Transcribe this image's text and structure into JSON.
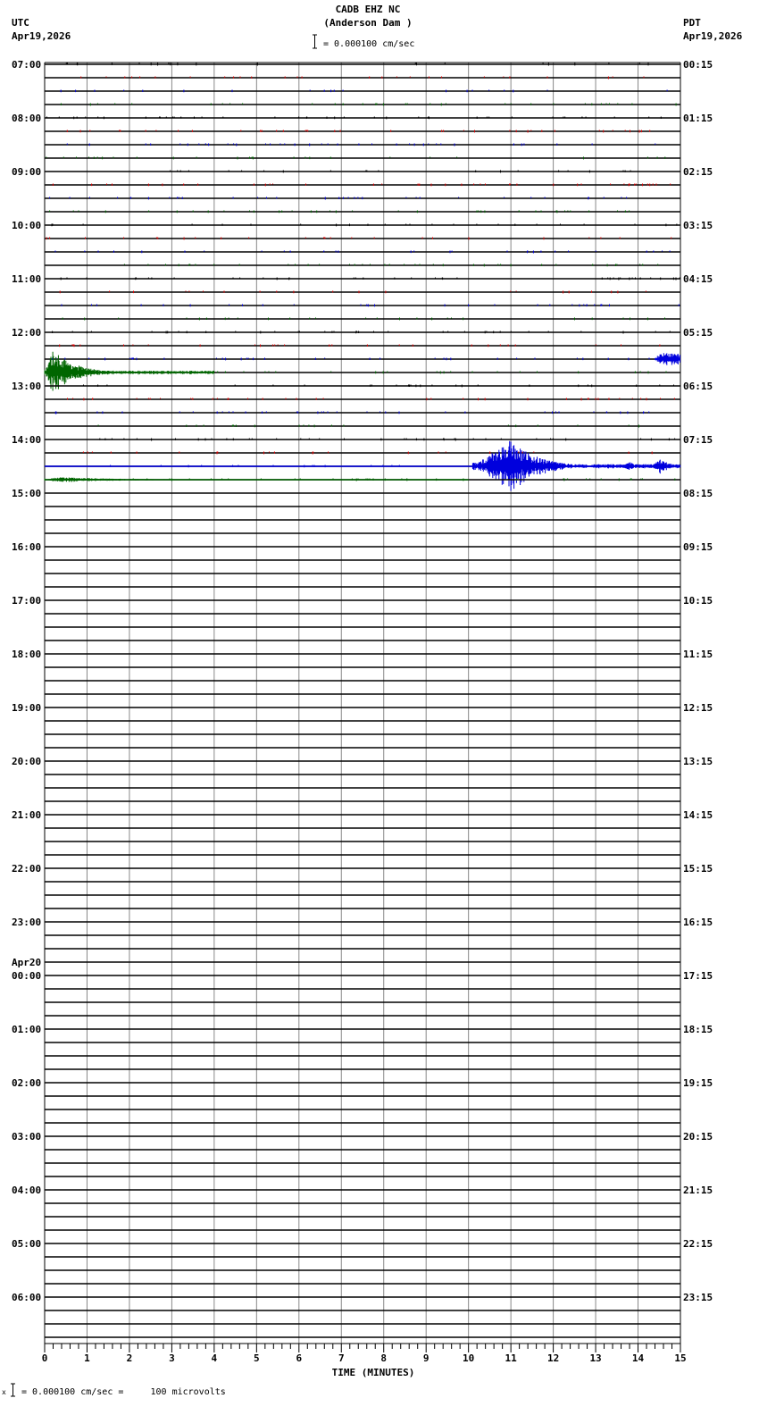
{
  "chart_data": {
    "type": "line",
    "title": "CADB EHZ NC",
    "subtitle": "(Anderson Dam )",
    "scale_label": "= 0.000100 cm/sec",
    "left_timezone": "UTC",
    "left_date": "Apr19,2026",
    "right_timezone": "PDT",
    "right_date": "Apr19,2026",
    "left_hour_labels": [
      "07:00",
      "08:00",
      "09:00",
      "10:00",
      "11:00",
      "12:00",
      "13:00",
      "14:00",
      "15:00",
      "16:00",
      "17:00",
      "18:00",
      "19:00",
      "20:00",
      "21:00",
      "22:00",
      "23:00",
      "00:00",
      "01:00",
      "02:00",
      "03:00",
      "04:00",
      "05:00",
      "06:00"
    ],
    "date_change_label": "Apr20",
    "right_hour_labels": [
      "00:15",
      "01:15",
      "02:15",
      "03:15",
      "04:15",
      "05:15",
      "06:15",
      "07:15",
      "08:15",
      "09:15",
      "10:15",
      "11:15",
      "12:15",
      "13:15",
      "14:15",
      "15:15",
      "16:15",
      "17:15",
      "18:15",
      "19:15",
      "20:15",
      "21:15",
      "22:15",
      "23:15"
    ],
    "x_ticks": [
      "0",
      "1",
      "2",
      "3",
      "4",
      "5",
      "6",
      "7",
      "8",
      "9",
      "10",
      "11",
      "12",
      "13",
      "14",
      "15"
    ],
    "xlabel": "TIME (MINUTES)",
    "xlim": [
      0,
      15
    ],
    "minutes_per_line": 15,
    "lines_with_data": 32,
    "trace_colors": [
      "#000000",
      "#dd0000",
      "#0000dd",
      "#006600"
    ],
    "events": [
      {
        "line_start": "12:30 UTC",
        "start_min": 14.4,
        "end_min": 15.0,
        "peak_min": 14.5,
        "amplitude": "small"
      },
      {
        "line_start": "12:45 UTC",
        "start_min": 0.0,
        "end_min": 4.0,
        "peak_min": 0.2,
        "amplitude": "large"
      },
      {
        "line_start": "14:30 UTC",
        "start_min": 10.1,
        "end_min": 15.0,
        "peak_min": 11.0,
        "amplitude": "large"
      },
      {
        "line_start": "14:45 UTC",
        "start_min": 0.0,
        "end_min": 10.0,
        "peak_min": 0.3,
        "amplitude": "small"
      }
    ],
    "footer_note": "= 0.000100 cm/sec =     100 microvolts",
    "footer_mark": "x"
  }
}
